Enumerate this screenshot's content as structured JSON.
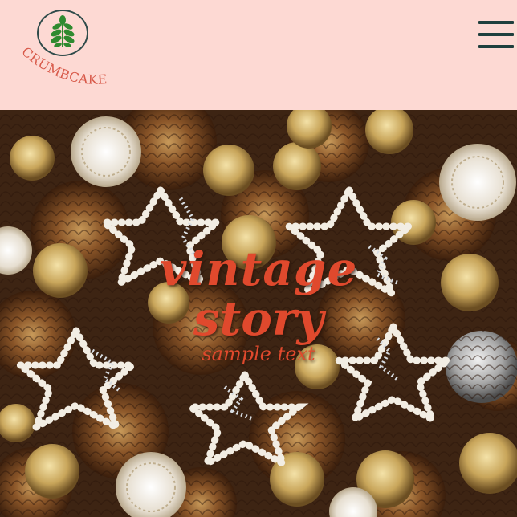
{
  "brand": {
    "name": "CRUMBCAKES",
    "icon": "leaf-sprig-icon",
    "text_color": "#d85a4a",
    "ring_color": "#2f4b4a",
    "leaf_color": "#2f8a2f"
  },
  "header": {
    "background": "#fdd9d3",
    "menu_icon": "hamburger-menu-icon"
  },
  "hero": {
    "title_line1": "vintage",
    "title_line2": "story",
    "subtitle": "sample text",
    "text_color": "#e0492d"
  }
}
